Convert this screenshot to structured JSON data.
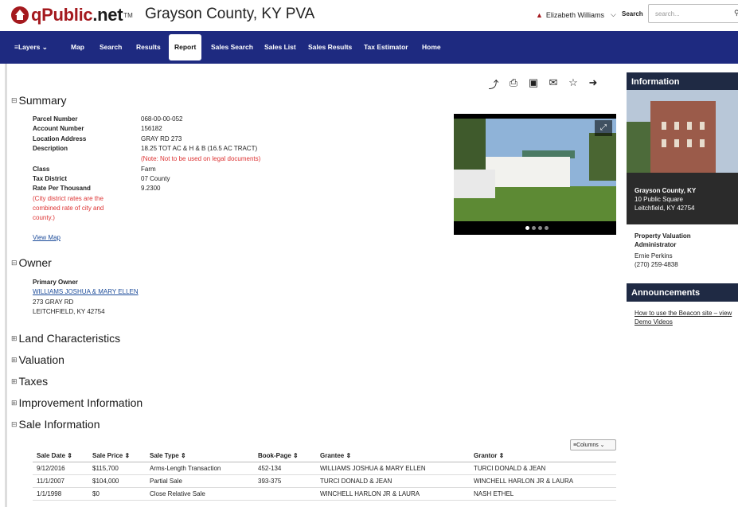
{
  "header": {
    "brand_q": "q",
    "brand_public": "Public",
    "brand_net": ".net",
    "tm": "TM",
    "county": "Grayson County, KY PVA",
    "user": "Elizabeth Williams",
    "search_label": "Search",
    "search_placeholder": "search..."
  },
  "nav": {
    "items": [
      "Layers",
      "Map",
      "Search",
      "Results",
      "Report",
      "Sales Search",
      "Sales List",
      "Sales Results",
      "Tax Estimator",
      "Home"
    ],
    "active": "Report"
  },
  "summary": {
    "title": "Summary",
    "fields": [
      {
        "label": "Parcel Number",
        "value": "068-00-00-052"
      },
      {
        "label": "Account Number",
        "value": "156182"
      },
      {
        "label": "Location Address",
        "value": "GRAY RD 273"
      },
      {
        "label": "Description",
        "value": "18.25 TOT AC & H & B (16.5 AC TRACT)"
      },
      {
        "label": "Class",
        "value": "Farm"
      },
      {
        "label": "Tax District",
        "value": "07 County"
      },
      {
        "label": "Rate Per Thousand",
        "value": "9.2300"
      }
    ],
    "description_note": "(Note: Not to be used on legal documents)",
    "rate_note": [
      "(City district rates are the",
      "combined rate of city and",
      "county.)"
    ],
    "view_map": "View Map"
  },
  "owner": {
    "title": "Owner",
    "primary_label": "Primary Owner",
    "name": "WILLIAMS JOSHUA & MARY ELLEN",
    "address1": "273 GRAY RD",
    "address2": "LEITCHFIELD, KY 42754"
  },
  "sections": [
    "Land Characteristics",
    "Valuation",
    "Taxes",
    "Improvement Information"
  ],
  "sales": {
    "title": "Sale Information",
    "columns_button": "Columns",
    "headers": [
      "Sale Date",
      "Sale Price",
      "Sale Type",
      "Book-Page",
      "Grantee",
      "Grantor"
    ],
    "rows": [
      [
        "9/12/2016",
        "$115,700",
        "Arms-Length Transaction",
        "452-134",
        "WILLIAMS JOSHUA & MARY ELLEN",
        "TURCI DONALD & JEAN"
      ],
      [
        "11/1/2007",
        "$104,000",
        "Partial Sale",
        "393-375",
        "TURCI DONALD & JEAN",
        "WINCHELL HARLON JR & LAURA"
      ],
      [
        "1/1/1998",
        "$0",
        "Close Relative Sale",
        "",
        "WINCHELL HARLON JR & LAURA",
        "NASH ETHEL"
      ]
    ]
  },
  "sidebar": {
    "info_title": "Information",
    "office_name": "Grayson County, KY",
    "office_street": "10 Public Square",
    "office_city": "Leitchfield, KY 42754",
    "pva_title1": "Property Valuation",
    "pva_title2": "Administrator",
    "pva_name": "Ernie Perkins",
    "pva_phone": "(270) 259-4838",
    "announce_title": "Announcements",
    "announce_link1": "How to use the Beacon site – view",
    "announce_link2": "Demo Videos"
  },
  "colors": {
    "nav_bg": "#1e2a80",
    "brand_red": "#a4191e",
    "link": "#1d4c9a",
    "note_red": "#dd3333"
  }
}
